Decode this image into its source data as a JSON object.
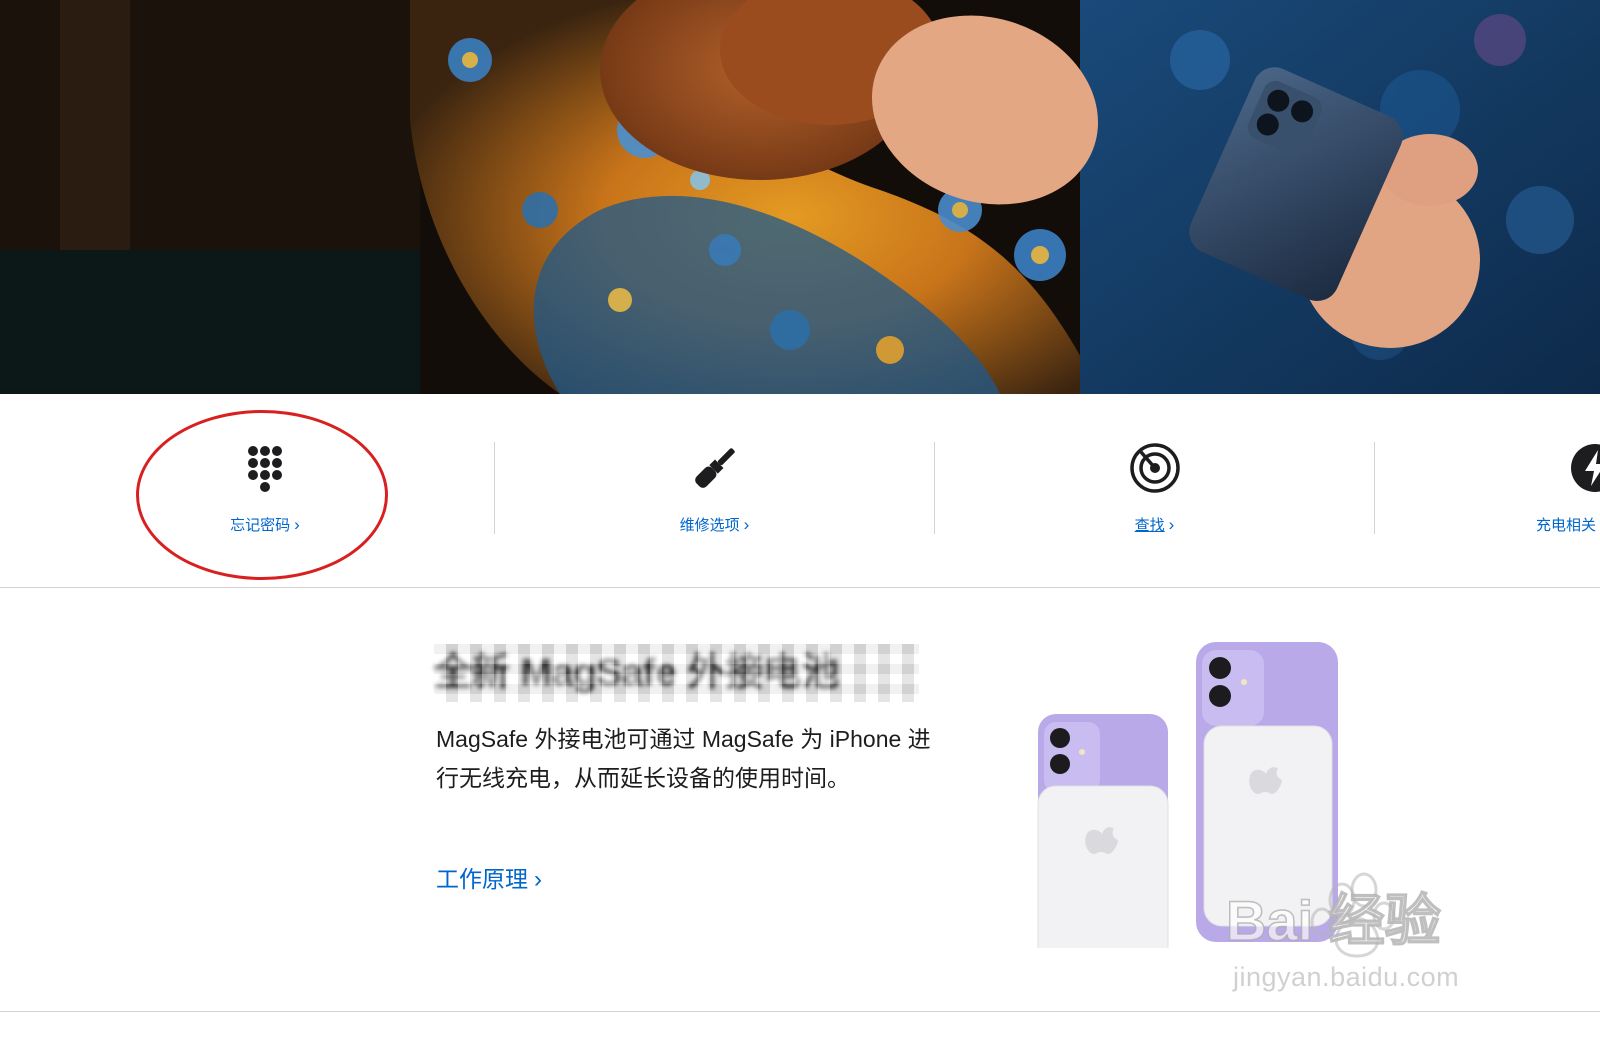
{
  "hero": {
    "image": "woman-with-iphone-on-floral-sofa"
  },
  "quick_links": [
    {
      "label": "忘记密码",
      "chevron": "›",
      "icon": "keypad-icon"
    },
    {
      "label": "维修选项",
      "chevron": "›",
      "icon": "screwdriver-icon"
    },
    {
      "label": "查找",
      "chevron": "›",
      "icon": "find-my-icon"
    },
    {
      "label": "充电相关",
      "chevron": "",
      "icon": "charging-icon"
    }
  ],
  "product": {
    "title": "全新 MagSafe 外接电池",
    "description": "MagSafe 外接电池可通过 MagSafe 为 iPhone 进行无线充电，从而延长设备的使用时间。",
    "link_label": "工作原理",
    "link_chevron": "›",
    "image": "iphone-with-magsafe-battery-pack"
  },
  "watermark": {
    "logo": "Bai 经验",
    "url": "jingyan.baidu.com"
  },
  "colors": {
    "link": "#0066cc",
    "text": "#1d1d1f",
    "divider": "#d2d2d7",
    "highlight": "#d92020",
    "phone_purple": "#b9a9e8",
    "battery_white": "#f2f2f4"
  }
}
